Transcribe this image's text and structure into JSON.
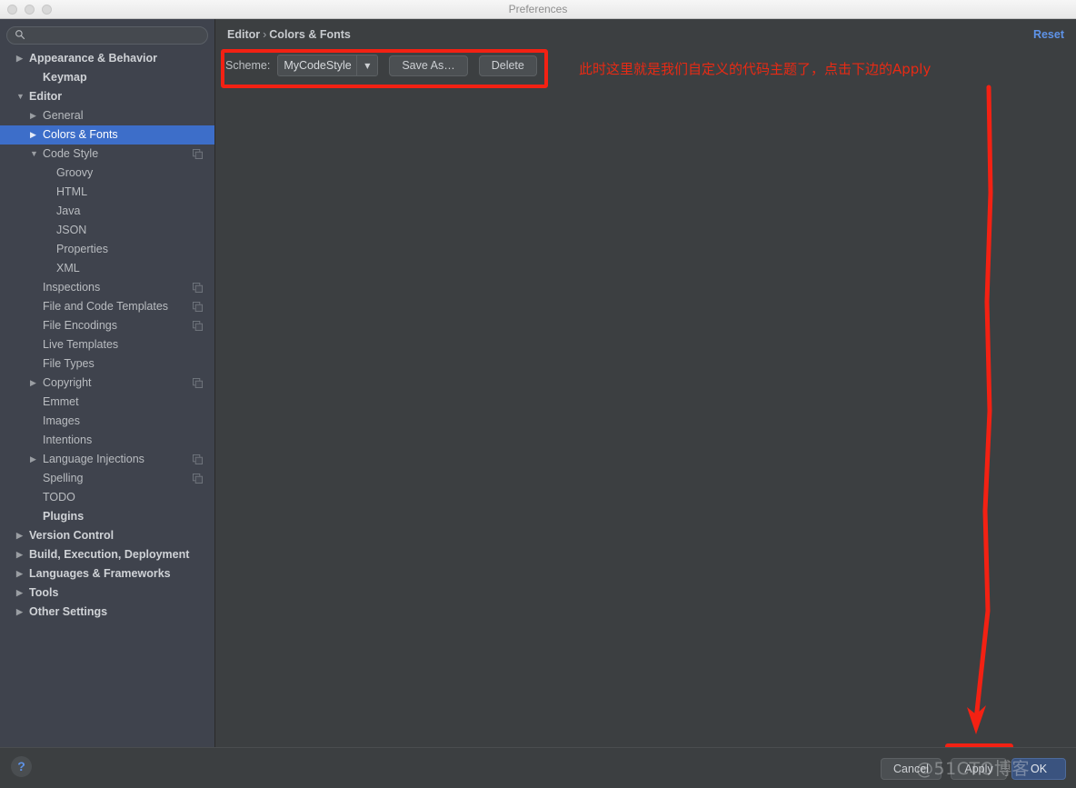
{
  "window": {
    "title": "Preferences",
    "traffic_lights": [
      "close",
      "minimize",
      "zoom"
    ]
  },
  "sidebar": {
    "search": {
      "value": "",
      "placeholder": ""
    },
    "items": [
      {
        "label": "Appearance & Behavior",
        "indent": 0,
        "arrow": "right",
        "bold": true,
        "selected": false,
        "copy": false
      },
      {
        "label": "Keymap",
        "indent": 1,
        "arrow": "",
        "bold": true,
        "selected": false,
        "copy": false
      },
      {
        "label": "Editor",
        "indent": 0,
        "arrow": "down",
        "bold": true,
        "selected": false,
        "copy": false
      },
      {
        "label": "General",
        "indent": 1,
        "arrow": "right",
        "bold": false,
        "selected": false,
        "copy": false
      },
      {
        "label": "Colors & Fonts",
        "indent": 1,
        "arrow": "right",
        "bold": false,
        "selected": true,
        "copy": false
      },
      {
        "label": "Code Style",
        "indent": 1,
        "arrow": "down",
        "bold": false,
        "selected": false,
        "copy": true
      },
      {
        "label": "Groovy",
        "indent": 2,
        "arrow": "",
        "bold": false,
        "selected": false,
        "copy": false
      },
      {
        "label": "HTML",
        "indent": 2,
        "arrow": "",
        "bold": false,
        "selected": false,
        "copy": false
      },
      {
        "label": "Java",
        "indent": 2,
        "arrow": "",
        "bold": false,
        "selected": false,
        "copy": false
      },
      {
        "label": "JSON",
        "indent": 2,
        "arrow": "",
        "bold": false,
        "selected": false,
        "copy": false
      },
      {
        "label": "Properties",
        "indent": 2,
        "arrow": "",
        "bold": false,
        "selected": false,
        "copy": false
      },
      {
        "label": "XML",
        "indent": 2,
        "arrow": "",
        "bold": false,
        "selected": false,
        "copy": false
      },
      {
        "label": "Inspections",
        "indent": 1,
        "arrow": "",
        "bold": false,
        "selected": false,
        "copy": true
      },
      {
        "label": "File and Code Templates",
        "indent": 1,
        "arrow": "",
        "bold": false,
        "selected": false,
        "copy": true
      },
      {
        "label": "File Encodings",
        "indent": 1,
        "arrow": "",
        "bold": false,
        "selected": false,
        "copy": true
      },
      {
        "label": "Live Templates",
        "indent": 1,
        "arrow": "",
        "bold": false,
        "selected": false,
        "copy": false
      },
      {
        "label": "File Types",
        "indent": 1,
        "arrow": "",
        "bold": false,
        "selected": false,
        "copy": false
      },
      {
        "label": "Copyright",
        "indent": 1,
        "arrow": "right",
        "bold": false,
        "selected": false,
        "copy": true
      },
      {
        "label": "Emmet",
        "indent": 1,
        "arrow": "",
        "bold": false,
        "selected": false,
        "copy": false
      },
      {
        "label": "Images",
        "indent": 1,
        "arrow": "",
        "bold": false,
        "selected": false,
        "copy": false
      },
      {
        "label": "Intentions",
        "indent": 1,
        "arrow": "",
        "bold": false,
        "selected": false,
        "copy": false
      },
      {
        "label": "Language Injections",
        "indent": 1,
        "arrow": "right",
        "bold": false,
        "selected": false,
        "copy": true
      },
      {
        "label": "Spelling",
        "indent": 1,
        "arrow": "",
        "bold": false,
        "selected": false,
        "copy": true
      },
      {
        "label": "TODO",
        "indent": 1,
        "arrow": "",
        "bold": false,
        "selected": false,
        "copy": false
      },
      {
        "label": "Plugins",
        "indent": 1,
        "arrow": "",
        "bold": true,
        "selected": false,
        "copy": false
      },
      {
        "label": "Version Control",
        "indent": 0,
        "arrow": "right",
        "bold": true,
        "selected": false,
        "copy": false
      },
      {
        "label": "Build, Execution, Deployment",
        "indent": 0,
        "arrow": "right",
        "bold": true,
        "selected": false,
        "copy": false
      },
      {
        "label": "Languages & Frameworks",
        "indent": 0,
        "arrow": "right",
        "bold": true,
        "selected": false,
        "copy": false
      },
      {
        "label": "Tools",
        "indent": 0,
        "arrow": "right",
        "bold": true,
        "selected": false,
        "copy": false
      },
      {
        "label": "Other Settings",
        "indent": 0,
        "arrow": "right",
        "bold": true,
        "selected": false,
        "copy": false
      }
    ]
  },
  "main": {
    "breadcrumb": {
      "parent": "Editor",
      "separator": "›",
      "current": "Colors & Fonts"
    },
    "reset_label": "Reset",
    "scheme": {
      "label": "Scheme:",
      "value": "MyCodeStyle",
      "dropdown_icon": "▼",
      "save_as_label": "Save As…",
      "delete_label": "Delete"
    }
  },
  "annotations": {
    "note_text": "此时这里就是我们自定义的代码主题了，点击下边的Apply",
    "highlight_color": "#f32113",
    "arrow_target": "Apply"
  },
  "footer": {
    "help_label": "?",
    "cancel_label": "Cancel",
    "apply_label": "Apply",
    "ok_label": "OK",
    "watermark": "@51CTO博客"
  },
  "colors": {
    "window_bg": "#3c3f41",
    "sidebar_bg": "#3f434d",
    "selection_blue": "#3d6ec9",
    "link_blue": "#5e93e8",
    "annotation_red": "#f32113",
    "default_button_blue": "#3a537f"
  }
}
